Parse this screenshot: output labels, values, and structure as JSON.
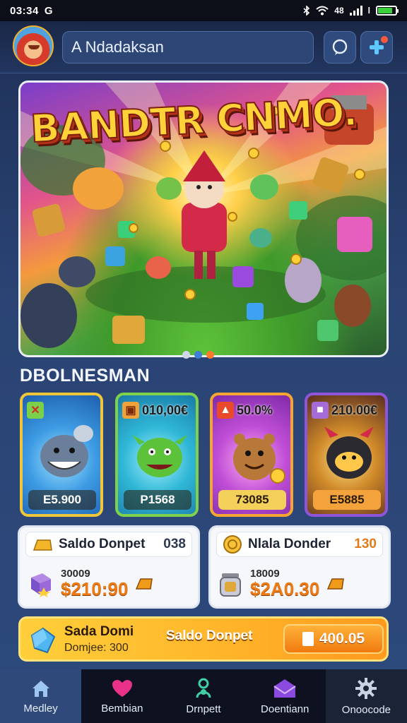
{
  "status_bar": {
    "time": "03:34",
    "indicators": "48"
  },
  "header": {
    "search_value": "A Ndadaksan",
    "icons": [
      "bluetooth-icon",
      "wifi-icon",
      "signal-icon",
      "battery-icon",
      "chat-icon",
      "add-icon"
    ]
  },
  "banner": {
    "title": "BANDTR CNMO.",
    "page_count": 3,
    "active_page": 2
  },
  "section": {
    "title": "DBOLNESMAN"
  },
  "cards": [
    {
      "tag": "",
      "tag_icon": "close-icon",
      "price": "E5.900"
    },
    {
      "tag": "010,00€",
      "tag_icon": "ticket-icon",
      "price": "P1568"
    },
    {
      "tag": "50.0%",
      "tag_icon": "bell-icon",
      "price": "73085"
    },
    {
      "tag": "210.00€",
      "tag_icon": "chest-icon",
      "price": "E5885"
    }
  ],
  "panels": [
    {
      "title": "Saldo Donpet",
      "count": "038",
      "small": "30009",
      "big": "$210:90",
      "icon": "gold-bar-icon"
    },
    {
      "title": "Nlala Donder",
      "count": "130",
      "small": "18009",
      "big": "$2A0.30",
      "icon": "coin-icon"
    }
  ],
  "goldbar": {
    "label": "Sada Domi",
    "sub": "Domjee: 300",
    "middle": "Saldo Donpet",
    "button": "400.05"
  },
  "nav": [
    {
      "label": "Medley",
      "icon": "home-icon"
    },
    {
      "label": "Bembian",
      "icon": "heart-icon"
    },
    {
      "label": "Drnpett",
      "icon": "figure-icon"
    },
    {
      "label": "Doentiann",
      "icon": "mail-icon"
    },
    {
      "label": "Onoocode",
      "icon": "gear-icon"
    }
  ],
  "colors": {
    "accent": "#ff9a1f",
    "nav_active": "#2f4a7a",
    "panel_orange": "#ee7a12"
  }
}
